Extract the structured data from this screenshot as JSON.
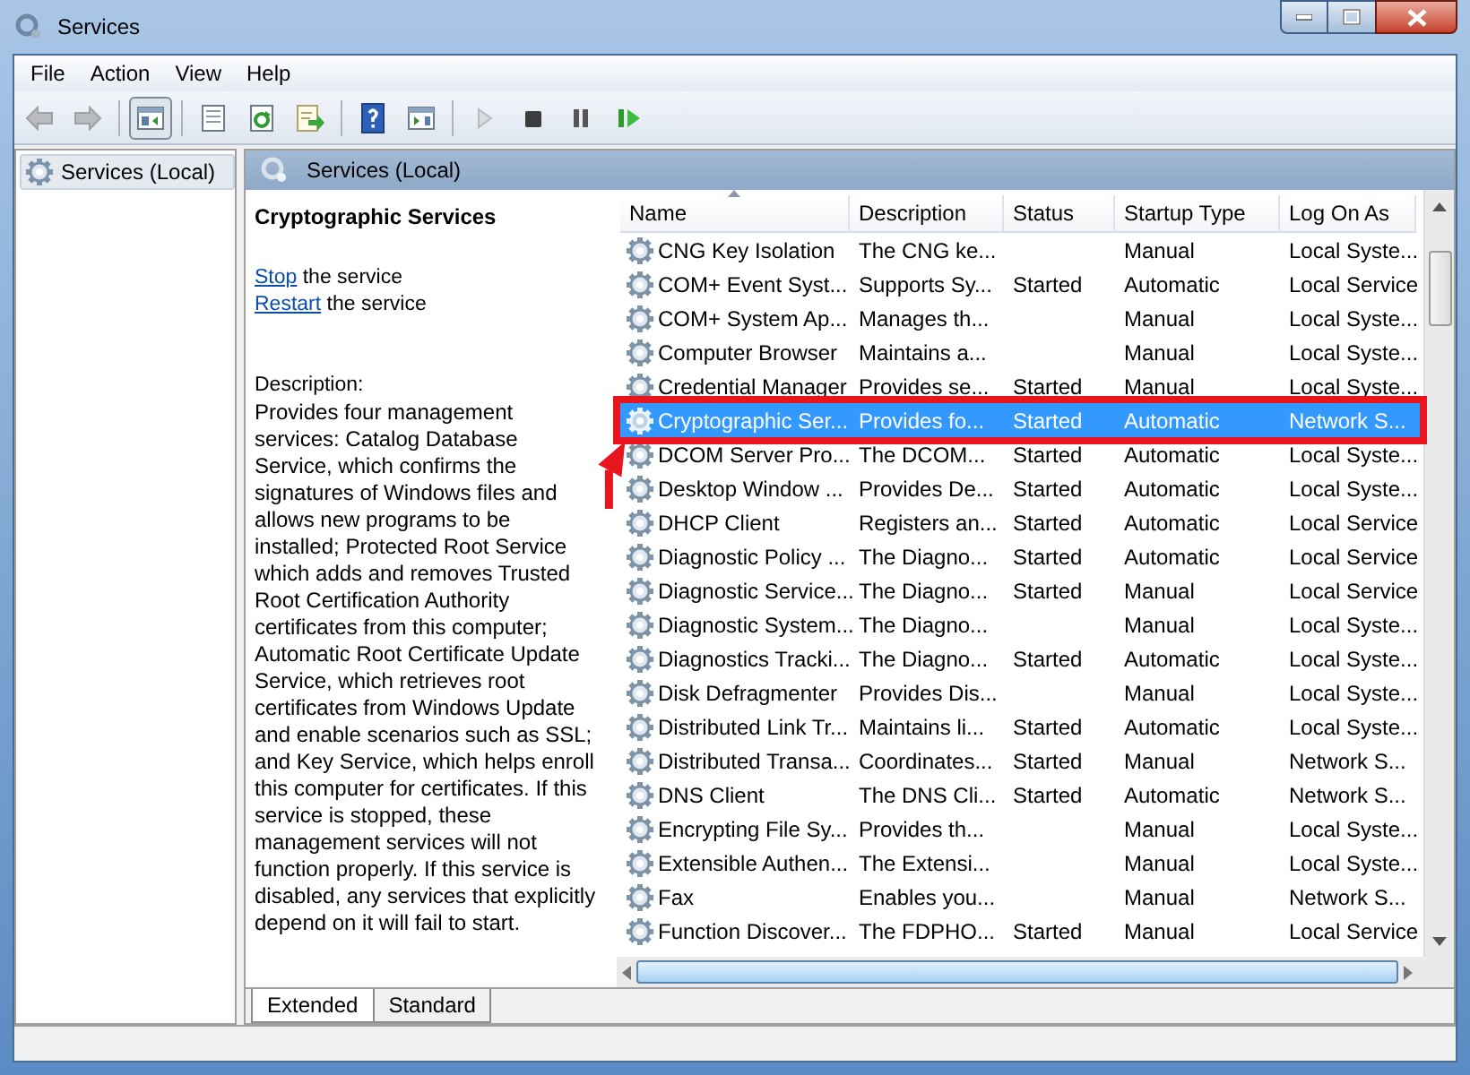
{
  "window": {
    "title": "Services"
  },
  "menu": [
    "File",
    "Action",
    "View",
    "Help"
  ],
  "toolbar": [
    {
      "kind": "back",
      "disabled": true,
      "pressed": false
    },
    {
      "kind": "forward",
      "disabled": true,
      "pressed": false
    },
    {
      "kind": "sep"
    },
    {
      "kind": "console",
      "disabled": false,
      "pressed": true
    },
    {
      "kind": "sep"
    },
    {
      "kind": "properties",
      "disabled": false,
      "pressed": false
    },
    {
      "kind": "refresh",
      "disabled": false,
      "pressed": false
    },
    {
      "kind": "export",
      "disabled": false,
      "pressed": false
    },
    {
      "kind": "sep"
    },
    {
      "kind": "help",
      "disabled": false,
      "pressed": false
    },
    {
      "kind": "view",
      "disabled": false,
      "pressed": false
    },
    {
      "kind": "sep"
    },
    {
      "kind": "play",
      "disabled": true,
      "pressed": false
    },
    {
      "kind": "stop",
      "disabled": false,
      "pressed": false
    },
    {
      "kind": "pause",
      "disabled": false,
      "pressed": false
    },
    {
      "kind": "resume",
      "disabled": false,
      "pressed": false
    }
  ],
  "tree": [
    {
      "label": "Services (Local)",
      "selected": true
    }
  ],
  "pane_header": "Services (Local)",
  "details": {
    "title": "Cryptographic Services",
    "actions": [
      {
        "link": "Stop",
        "text": "the service"
      },
      {
        "link": "Restart",
        "text": "the service"
      }
    ],
    "description_label": "Description:",
    "description": "Provides four management services: Catalog Database Service, which confirms the signatures of Windows files and allows new programs to be installed; Protected Root Service which adds and removes Trusted Root Certification Authority certificates from this computer; Automatic Root Certificate Update Service, which retrieves root certificates from Windows Update and enable scenarios such as SSL; and Key Service, which helps enroll this computer for certificates. If this service is stopped, these management services will not function properly. If this service is disabled, any services that explicitly depend on it will fail to start."
  },
  "table": {
    "columns": [
      {
        "label": "Name",
        "sorted": true
      },
      {
        "label": "Description",
        "sorted": false
      },
      {
        "label": "Status",
        "sorted": false
      },
      {
        "label": "Startup Type",
        "sorted": false
      },
      {
        "label": "Log On As",
        "sorted": false
      }
    ],
    "rows": [
      {
        "name": "CNG Key Isolation",
        "description": "The CNG ke...",
        "status": "",
        "startup_type": "Manual",
        "log_on_as": "Local Syste...",
        "selected": false,
        "highlighted": false
      },
      {
        "name": "COM+ Event Syst...",
        "description": "Supports Sy...",
        "status": "Started",
        "startup_type": "Automatic",
        "log_on_as": "Local Service",
        "selected": false,
        "highlighted": false
      },
      {
        "name": "COM+ System Ap...",
        "description": "Manages th...",
        "status": "",
        "startup_type": "Manual",
        "log_on_as": "Local Syste...",
        "selected": false,
        "highlighted": false
      },
      {
        "name": "Computer Browser",
        "description": "Maintains a...",
        "status": "",
        "startup_type": "Manual",
        "log_on_as": "Local Syste...",
        "selected": false,
        "highlighted": false
      },
      {
        "name": "Credential Manager",
        "description": "Provides se...",
        "status": "Started",
        "startup_type": "Manual",
        "log_on_as": "Local Syste...",
        "selected": false,
        "highlighted": false
      },
      {
        "name": "Cryptographic Ser...",
        "description": "Provides fo...",
        "status": "Started",
        "startup_type": "Automatic",
        "log_on_as": "Network S...",
        "selected": true,
        "highlighted": true
      },
      {
        "name": "DCOM Server Pro...",
        "description": "The DCOM...",
        "status": "Started",
        "startup_type": "Automatic",
        "log_on_as": "Local Syste...",
        "selected": false,
        "highlighted": false
      },
      {
        "name": "Desktop Window ...",
        "description": "Provides De...",
        "status": "Started",
        "startup_type": "Automatic",
        "log_on_as": "Local Syste...",
        "selected": false,
        "highlighted": false
      },
      {
        "name": "DHCP Client",
        "description": "Registers an...",
        "status": "Started",
        "startup_type": "Automatic",
        "log_on_as": "Local Service",
        "selected": false,
        "highlighted": false
      },
      {
        "name": "Diagnostic Policy ...",
        "description": "The Diagno...",
        "status": "Started",
        "startup_type": "Automatic",
        "log_on_as": "Local Service",
        "selected": false,
        "highlighted": false
      },
      {
        "name": "Diagnostic Service...",
        "description": "The Diagno...",
        "status": "Started",
        "startup_type": "Manual",
        "log_on_as": "Local Service",
        "selected": false,
        "highlighted": false
      },
      {
        "name": "Diagnostic System...",
        "description": "The Diagno...",
        "status": "",
        "startup_type": "Manual",
        "log_on_as": "Local Syste...",
        "selected": false,
        "highlighted": false
      },
      {
        "name": "Diagnostics Tracki...",
        "description": "The Diagno...",
        "status": "Started",
        "startup_type": "Automatic",
        "log_on_as": "Local Syste...",
        "selected": false,
        "highlighted": false
      },
      {
        "name": "Disk Defragmenter",
        "description": "Provides Dis...",
        "status": "",
        "startup_type": "Manual",
        "log_on_as": "Local Syste...",
        "selected": false,
        "highlighted": false
      },
      {
        "name": "Distributed Link Tr...",
        "description": "Maintains li...",
        "status": "Started",
        "startup_type": "Automatic",
        "log_on_as": "Local Syste...",
        "selected": false,
        "highlighted": false
      },
      {
        "name": "Distributed Transa...",
        "description": "Coordinates...",
        "status": "Started",
        "startup_type": "Manual",
        "log_on_as": "Network S...",
        "selected": false,
        "highlighted": false
      },
      {
        "name": "DNS Client",
        "description": "The DNS Cli...",
        "status": "Started",
        "startup_type": "Automatic",
        "log_on_as": "Network S...",
        "selected": false,
        "highlighted": false
      },
      {
        "name": "Encrypting File Sy...",
        "description": "Provides th...",
        "status": "",
        "startup_type": "Manual",
        "log_on_as": "Local Syste...",
        "selected": false,
        "highlighted": false
      },
      {
        "name": "Extensible Authen...",
        "description": "The Extensi...",
        "status": "",
        "startup_type": "Manual",
        "log_on_as": "Local Syste...",
        "selected": false,
        "highlighted": false
      },
      {
        "name": "Fax",
        "description": "Enables you...",
        "status": "",
        "startup_type": "Manual",
        "log_on_as": "Network S...",
        "selected": false,
        "highlighted": false
      },
      {
        "name": "Function Discover...",
        "description": "The FDPHO...",
        "status": "Started",
        "startup_type": "Manual",
        "log_on_as": "Local Service",
        "selected": false,
        "highlighted": false
      }
    ]
  },
  "tabs": [
    {
      "label": "Extended",
      "selected": true
    },
    {
      "label": "Standard",
      "selected": false
    }
  ]
}
